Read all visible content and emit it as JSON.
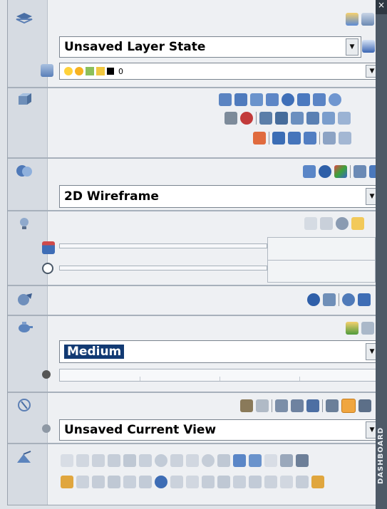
{
  "layers": {
    "layer_state": "Unsaved Layer State",
    "layer_name": "0"
  },
  "visual_style": {
    "current": "2D Wireframe"
  },
  "materials": {
    "quality": "Medium"
  },
  "views": {
    "current_view": "Unsaved Current View"
  },
  "dashboard": {
    "title": "DASHBOARD",
    "close_glyph": "×"
  },
  "icons": {
    "dropdown_arrow": "▼",
    "layers_panel": "layers-icon",
    "solids_panel": "3d-box-icon",
    "visual_panel": "spheres-icon",
    "lights_panel": "lightbulb-icon",
    "render_panel": "teapot-icon",
    "navigate_panel": "compass-icon",
    "draw_panel": "draw-icon"
  },
  "colors": {
    "accent_blue": "#2c66c8",
    "highlight": "#123a73",
    "orange": "#f0a640"
  }
}
